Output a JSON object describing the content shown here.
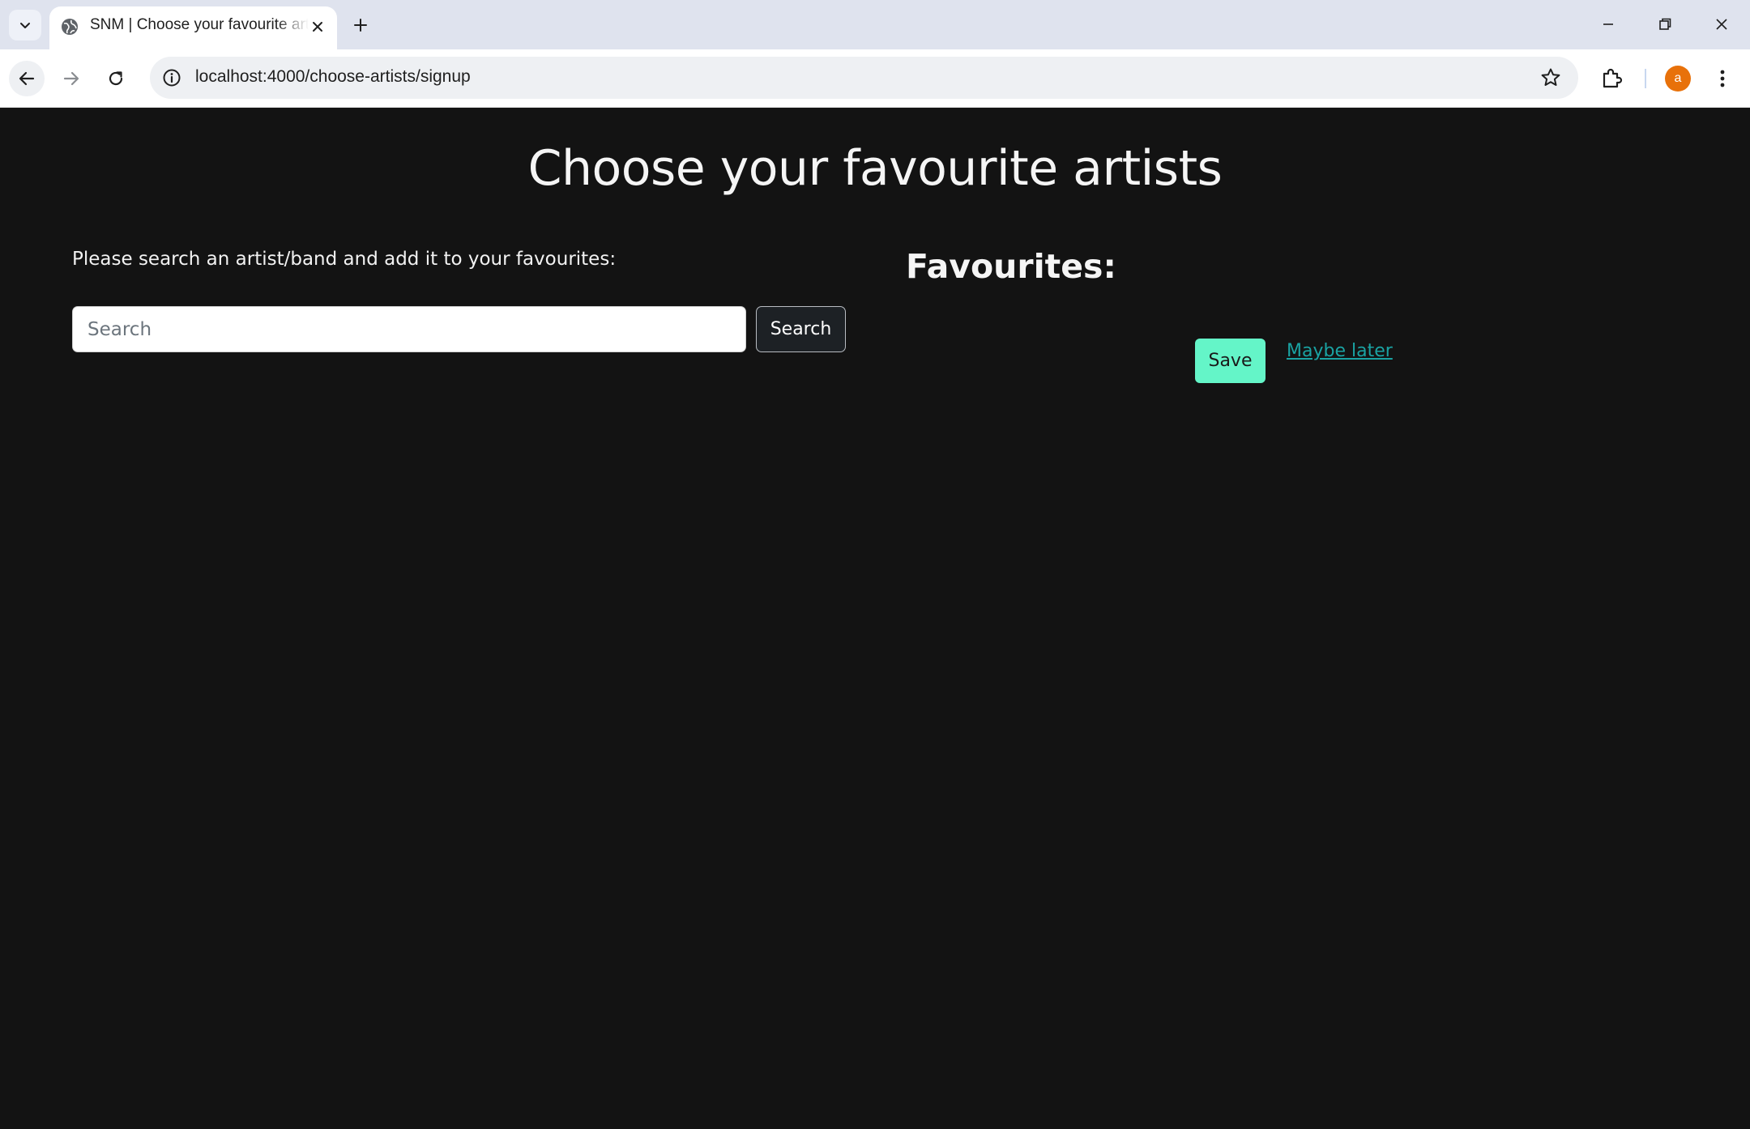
{
  "browser": {
    "tab": {
      "title": "SNM | Choose your favourite artists",
      "favicon": "globe-icon"
    },
    "address_bar": {
      "url": "localhost:4000/choose-artists/signup"
    },
    "profile_avatar": "a",
    "colors": {
      "tabstrip": "#dfe3ee",
      "avatar": "#e8710a"
    }
  },
  "page": {
    "title": "Choose your favourite artists",
    "instructions": "Please search an artist/band and add it to your favourites:",
    "search": {
      "placeholder": "Search",
      "value": "",
      "button_label": "Search"
    },
    "favourites": {
      "heading": "Favourites:",
      "items": []
    },
    "actions": {
      "save_label": "Save",
      "maybe_later_label": "Maybe later"
    },
    "colors": {
      "background": "#131313",
      "save_button": "#64f5c8",
      "link": "#1aa3a3"
    }
  }
}
